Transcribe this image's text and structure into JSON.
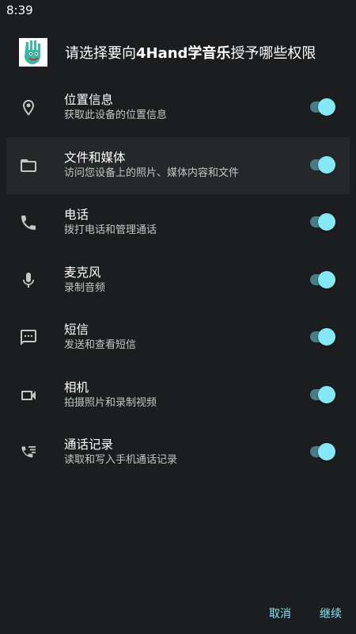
{
  "status_bar": {
    "time": "8:39"
  },
  "header": {
    "title_prefix": "请选择要向",
    "app_name": "4Hand学音乐",
    "title_suffix": "授予哪些权限",
    "logo_icon": "hand-logo-icon"
  },
  "permissions": [
    {
      "title": "位置信息",
      "description": "获取此设备的位置信息",
      "icon": "location-pin-icon",
      "enabled": true
    },
    {
      "title": "文件和媒体",
      "description": "访问您设备上的照片、媒体内容和文件",
      "icon": "folder-icon",
      "enabled": true
    },
    {
      "title": "电话",
      "description": "拨打电话和管理通话",
      "icon": "phone-icon",
      "enabled": true
    },
    {
      "title": "麦克风",
      "description": "录制音频",
      "icon": "microphone-icon",
      "enabled": true
    },
    {
      "title": "短信",
      "description": "发送和查看短信",
      "icon": "sms-icon",
      "enabled": true
    },
    {
      "title": "相机",
      "description": "拍摄照片和录制视频",
      "icon": "video-camera-icon",
      "enabled": true
    },
    {
      "title": "通话记录",
      "description": "读取和写入手机通话记录",
      "icon": "call-log-icon",
      "enabled": true
    }
  ],
  "footer": {
    "cancel_label": "取消",
    "continue_label": "继续"
  },
  "colors": {
    "background": "#1b1d1f",
    "accent": "#84e9f6",
    "toggle_track": "#4a7c83",
    "highlight_row": "#252729"
  }
}
